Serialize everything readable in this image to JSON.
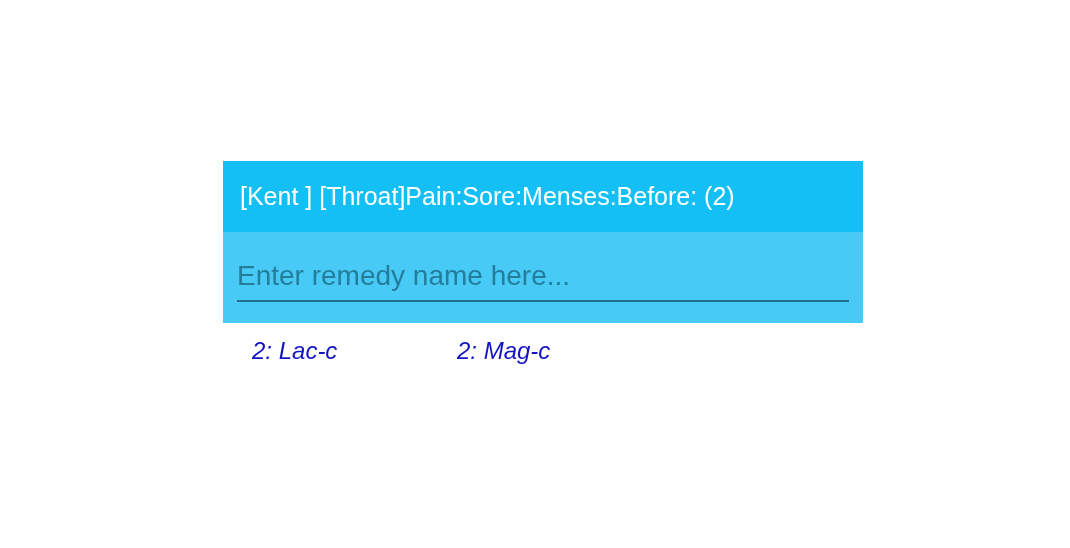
{
  "header": {
    "title": "[Kent ] [Throat]Pain:Sore:Menses:Before: (2)"
  },
  "search": {
    "placeholder": "Enter remedy name here..."
  },
  "remedies": [
    {
      "label": "2: Lac-c"
    },
    {
      "label": "2: Mag-c"
    }
  ]
}
